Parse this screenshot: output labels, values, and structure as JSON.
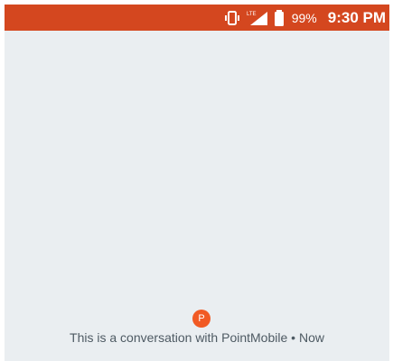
{
  "status_bar": {
    "network_label": "LTE",
    "battery_percent": "99%",
    "time": "9:30 PM",
    "icons": [
      "vibrate-icon",
      "lte-icon",
      "signal-icon",
      "battery-icon"
    ],
    "background_color": "#d4471f"
  },
  "conversation": {
    "avatar_letter": "P",
    "intro_text": "This is a conversation with PointMobile",
    "separator": "•",
    "timestamp": "Now",
    "avatar_color": "#f15a24",
    "background_color": "#eaeef1"
  }
}
